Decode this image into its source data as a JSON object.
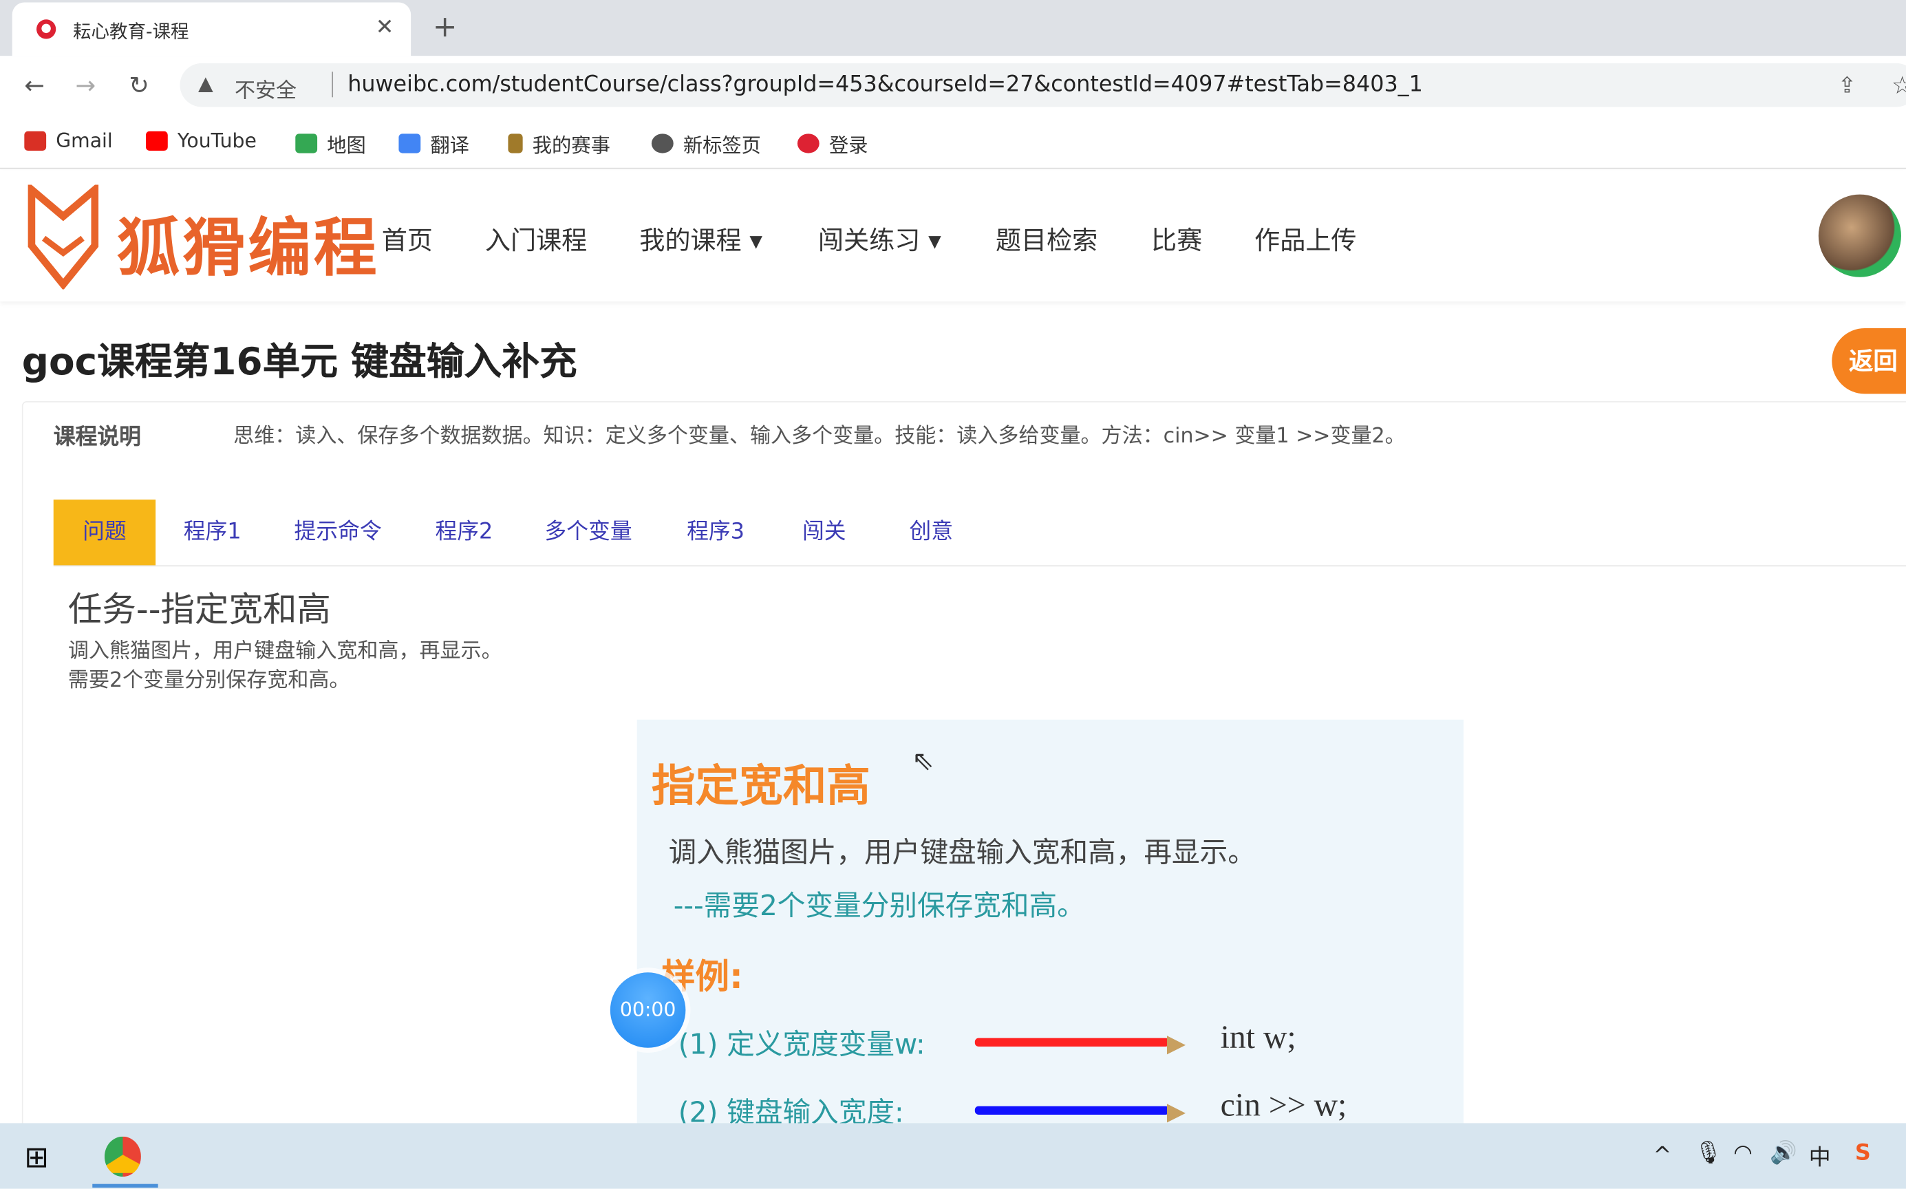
{
  "browser": {
    "tab_title": "耘心教育-课程",
    "address_warning": "不安全",
    "url": "huweibc.com/studentCourse/class?groupId=453&courseId=27&contestId=4097#testTab=8403_1",
    "bookmarks": [
      {
        "label": "Gmail",
        "icon": "gmail-icon",
        "color": "#d93025"
      },
      {
        "label": "YouTube",
        "icon": "youtube-icon",
        "color": "#ff0000"
      },
      {
        "label": "地图",
        "icon": "maps-icon",
        "color": "#34a853"
      },
      {
        "label": "翻译",
        "icon": "translate-icon",
        "color": "#4285f4"
      },
      {
        "label": "我的赛事",
        "icon": "trophy-icon",
        "color": "#a07a2a"
      },
      {
        "label": "新标签页",
        "icon": "globe-icon",
        "color": "#555555"
      },
      {
        "label": "登录",
        "icon": "site-icon",
        "color": "#dd2233"
      }
    ]
  },
  "site": {
    "logo_text": "狐猾编程",
    "menu": [
      "首页",
      "入门课程",
      "我的课程 ▾",
      "闯关练习 ▾",
      "题目检索",
      "比赛",
      "作品上传"
    ],
    "back_label": "返回"
  },
  "page": {
    "title": "goc课程第16单元 键盘输入补充",
    "desc_label": "课程说明",
    "description": "思维：读入、保存多个数据数据。知识：定义多个变量、输入多个变量。技能：读入多给变量。方法：cin>> 变量1 >>变量2。",
    "tabs": [
      "问题",
      "程序1",
      "提示命令",
      "程序2",
      "多个变量",
      "程序3",
      "闯关",
      "创意"
    ],
    "active_tab": "问题",
    "task_title": "任务--指定宽和高",
    "task_lines": [
      "调入熊猫图片，用户键盘输入宽和高，再显示。",
      "需要2个变量分别保存宽和高。"
    ],
    "image": {
      "title": "指定宽和高",
      "line1": "调入熊猫图片，用户键盘输入宽和高，再显示。",
      "line2": "---需要2个变量分别保存宽和高。",
      "example": "样例:",
      "step1": "(1) 定义宽度变量w:",
      "code1": "int w;",
      "step2": "(2) 键盘输入宽度:",
      "code2": "cin >> w;"
    },
    "timer": "00:00"
  },
  "colors": {
    "accent": "#f5821f",
    "active_tab": "#f7b718",
    "tab_text": "#3b3bb5"
  }
}
